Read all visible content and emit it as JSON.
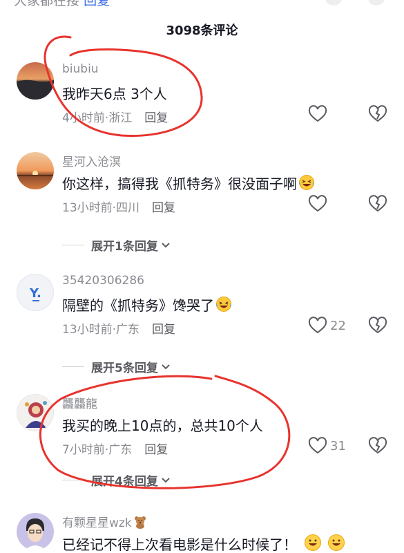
{
  "header": {
    "title": "3098条评论"
  },
  "top_cut": {
    "text": "大家都在接",
    "reply": "回复"
  },
  "comments": [
    {
      "username": "biubiu",
      "content": "我昨天6点 3个人",
      "time_location": "4小时前·浙江",
      "reply_label": "回复",
      "like_count": "",
      "expand_label": ""
    },
    {
      "username": "星河入沧溟",
      "content": "你这样，搞得我《抓特务》很没面子啊",
      "emoji": "laughing-crying-emoji",
      "time_location": "13小时前·四川",
      "reply_label": "回复",
      "like_count": "",
      "expand_label": "展开1条回复"
    },
    {
      "username": "35420306286",
      "content": "隔壁的《抓特务》馋哭了",
      "emoji": "laughing-crying-emoji",
      "time_location": "13小时前·广东",
      "reply_label": "回复",
      "like_count": "22",
      "expand_label": "展开5条回复"
    },
    {
      "username": "龘龘龍",
      "content": "我买的晚上10点的，总共10个人",
      "time_location": "7小时前·广东",
      "reply_label": "回复",
      "like_count": "31",
      "expand_label": "展开4条回复"
    },
    {
      "username": "有颗星星wzk",
      "username_emoji": "teddy-bear-emoji",
      "content": "已经记不得上次看电影是什么时候了！",
      "emoji": "grinning-emoji",
      "like_count": ""
    }
  ],
  "colors": {
    "annotation_red": "#e8332e",
    "text_primary": "#161823",
    "text_secondary": "#8a8b91"
  }
}
